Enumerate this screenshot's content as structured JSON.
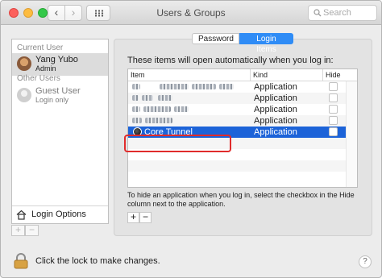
{
  "window": {
    "title": "Users & Groups",
    "search_placeholder": "Search"
  },
  "sidebar": {
    "current_user_header": "Current User",
    "current_user": {
      "name": "Yang Yubo",
      "role": "Admin"
    },
    "other_users_header": "Other Users",
    "guest_user": {
      "name": "Guest User",
      "status": "Login only"
    },
    "login_options_label": "Login Options",
    "add_label": "+",
    "remove_label": "−"
  },
  "tabs": [
    {
      "label": "Password",
      "selected": false
    },
    {
      "label": "Login Items",
      "selected": true
    }
  ],
  "login_items": {
    "intro": "These items will open automatically when you log in:",
    "columns": {
      "item": "Item",
      "kind": "Kind",
      "hide": "Hide"
    },
    "rows": [
      {
        "item": "",
        "kind": "Application",
        "hide": false,
        "selected": false
      },
      {
        "item": "",
        "kind": "Application",
        "hide": false,
        "selected": false
      },
      {
        "item": "",
        "kind": "Application",
        "hide": false,
        "selected": false
      },
      {
        "item": "",
        "kind": "Application",
        "hide": false,
        "selected": false
      },
      {
        "item": "Core Tunnel",
        "kind": "Application",
        "hide": false,
        "selected": true
      }
    ],
    "hint": "To hide an application when you log in, select the checkbox in the Hide column next to the application.",
    "add_label": "+",
    "remove_label": "−"
  },
  "footer": {
    "lock_text": "Click the lock to make changes.",
    "help_label": "?"
  },
  "colors": {
    "selection": "#1c63d8",
    "tab_selected": "#2f8cf6",
    "annotation_box": "#e02b2b"
  }
}
